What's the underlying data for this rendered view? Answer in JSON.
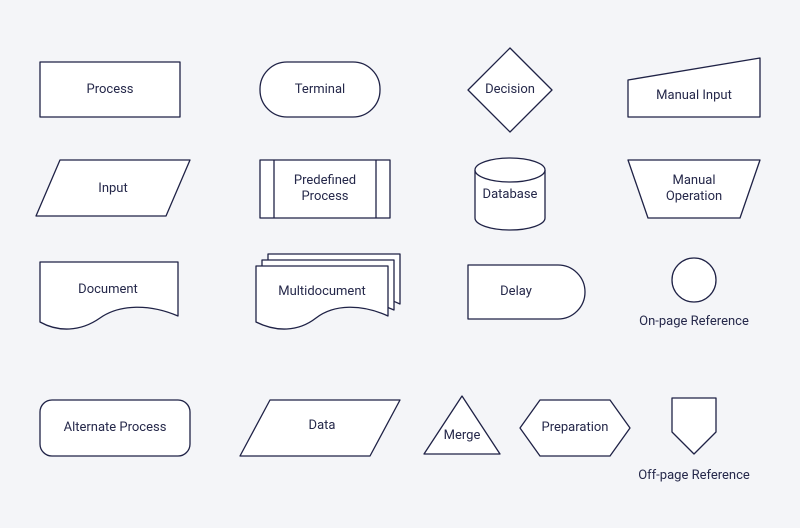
{
  "stroke": "#1f2246",
  "fill": "#ffffff",
  "shapes": {
    "process": {
      "label": "Process"
    },
    "terminal": {
      "label": "Terminal"
    },
    "decision": {
      "label": "Decision"
    },
    "manual_input": {
      "label": "Manual Input"
    },
    "input": {
      "label": "Input"
    },
    "predefined_process": {
      "label": "Predefined\nProcess"
    },
    "database": {
      "label": "Database"
    },
    "manual_operation": {
      "label": "Manual\nOperation"
    },
    "document": {
      "label": "Document"
    },
    "multidocument": {
      "label": "Multidocument"
    },
    "delay": {
      "label": "Delay"
    },
    "on_page_reference": {
      "label": "On-page Reference"
    },
    "alternate_process": {
      "label": "Alternate Process"
    },
    "data": {
      "label": "Data"
    },
    "merge": {
      "label": "Merge"
    },
    "preparation": {
      "label": "Preparation"
    },
    "off_page_reference": {
      "label": "Off-page Reference"
    }
  }
}
